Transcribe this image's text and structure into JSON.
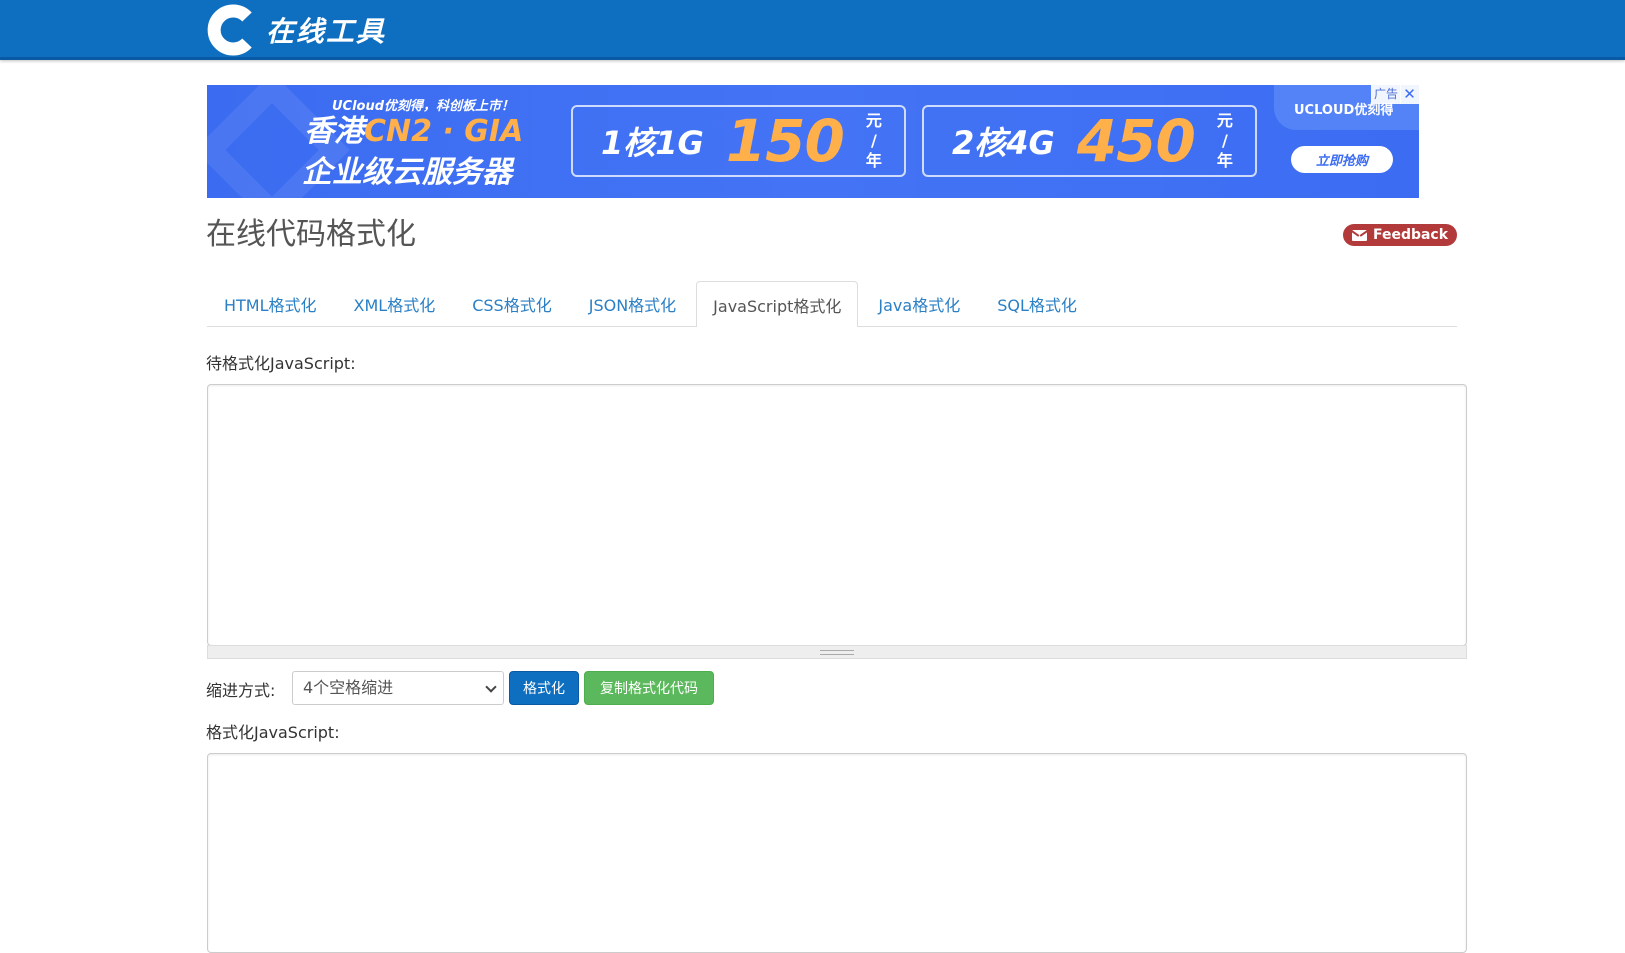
{
  "header": {
    "logo_text": "在线工具"
  },
  "ad": {
    "subtitle": "UCloud优刻得，科创板上市！",
    "headline_prefix": "香港",
    "headline_highlight": "CN2 · GIA",
    "headline_line2": "企业级云服务器",
    "offer1_spec": "1核1G",
    "offer1_price": "150",
    "offer2_spec": "2核4G",
    "offer2_price": "450",
    "unit": "元\n/\n年",
    "brand": "UCLOUD优刻得",
    "cta": "立即抢购",
    "tag": "广告",
    "close": "✕"
  },
  "page": {
    "title": "在线代码格式化",
    "feedback_label": "Feedback"
  },
  "tabs": [
    {
      "label": "HTML格式化",
      "active": false
    },
    {
      "label": "XML格式化",
      "active": false
    },
    {
      "label": "CSS格式化",
      "active": false
    },
    {
      "label": "JSON格式化",
      "active": false
    },
    {
      "label": "JavaScript格式化",
      "active": true
    },
    {
      "label": "Java格式化",
      "active": false
    },
    {
      "label": "SQL格式化",
      "active": false
    }
  ],
  "input": {
    "label": "待格式化JavaScript:",
    "value": ""
  },
  "controls": {
    "indent_label": "缩进方式:",
    "indent_selected": "4个空格缩进",
    "format_button": "格式化",
    "copy_button": "复制格式化代码"
  },
  "output": {
    "label": "格式化JavaScript:",
    "value": ""
  },
  "colors": {
    "header_bg": "#0e6ec0",
    "tab_link": "#2a7fc5",
    "feedback_bg": "#b23a3a",
    "format_btn": "#0e6ec0",
    "copy_btn": "#5cb85c",
    "ad_bg": "#3c6cf2",
    "ad_highlight": "#ffb04a"
  }
}
